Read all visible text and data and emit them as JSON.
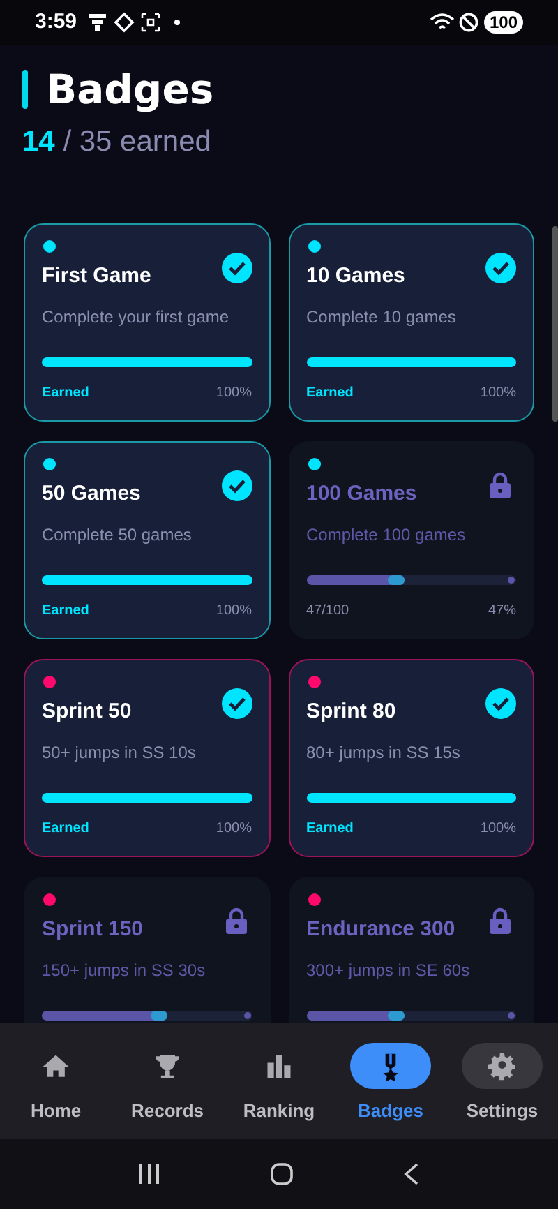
{
  "status_bar": {
    "time": "3:59",
    "battery": "100"
  },
  "header": {
    "title": "Badges",
    "earned_count": "14",
    "total_text": "/ 35 earned"
  },
  "badges": [
    {
      "title": "First Game",
      "description": "Complete your first game",
      "color": "#00e5ff",
      "earned": true,
      "level": 1,
      "status_text": "Earned",
      "percent": "100%"
    },
    {
      "title": "10 Games",
      "description": "Complete 10 games",
      "color": "#00e5ff",
      "earned": true,
      "level": 1,
      "status_text": "Earned",
      "percent": "100%"
    },
    {
      "title": "50 Games",
      "description": "Complete 50 games",
      "color": "#00e5ff",
      "earned": true,
      "level": 1,
      "status_text": "Earned",
      "percent": "100%"
    },
    {
      "title": "100 Games",
      "description": "Complete 100 games",
      "color": "#00e5ff",
      "earned": false,
      "level": 0.47,
      "status_text": "47/100",
      "percent": "47%"
    },
    {
      "title": "Sprint 50",
      "description": "50+ jumps in SS 10s",
      "color": "#ff0a6c",
      "earned": true,
      "level": 1,
      "status_text": "Earned",
      "percent": "100%"
    },
    {
      "title": "Sprint 80",
      "description": "80+ jumps in SS 15s",
      "color": "#ff0a6c",
      "earned": true,
      "level": 1,
      "status_text": "Earned",
      "percent": "100%"
    },
    {
      "title": "Sprint 150",
      "description": "150+ jumps in SS 30s",
      "color": "#ff0a6c",
      "earned": false,
      "level": 0.6
    },
    {
      "title": "Endurance 300",
      "description": "300+ jumps in SE 60s",
      "color": "#ff0a6c",
      "earned": false,
      "level": 0.47
    }
  ],
  "nav": [
    {
      "label": "Home",
      "kind": "home",
      "selected": false,
      "pressed": false
    },
    {
      "label": "Records",
      "kind": "trophy",
      "selected": false,
      "pressed": false
    },
    {
      "label": "Ranking",
      "kind": "chart",
      "selected": false,
      "pressed": false
    },
    {
      "label": "Badges",
      "kind": "medal",
      "selected": true,
      "pressed": false
    },
    {
      "label": "Settings",
      "kind": "gear",
      "selected": false,
      "pressed": true
    }
  ]
}
